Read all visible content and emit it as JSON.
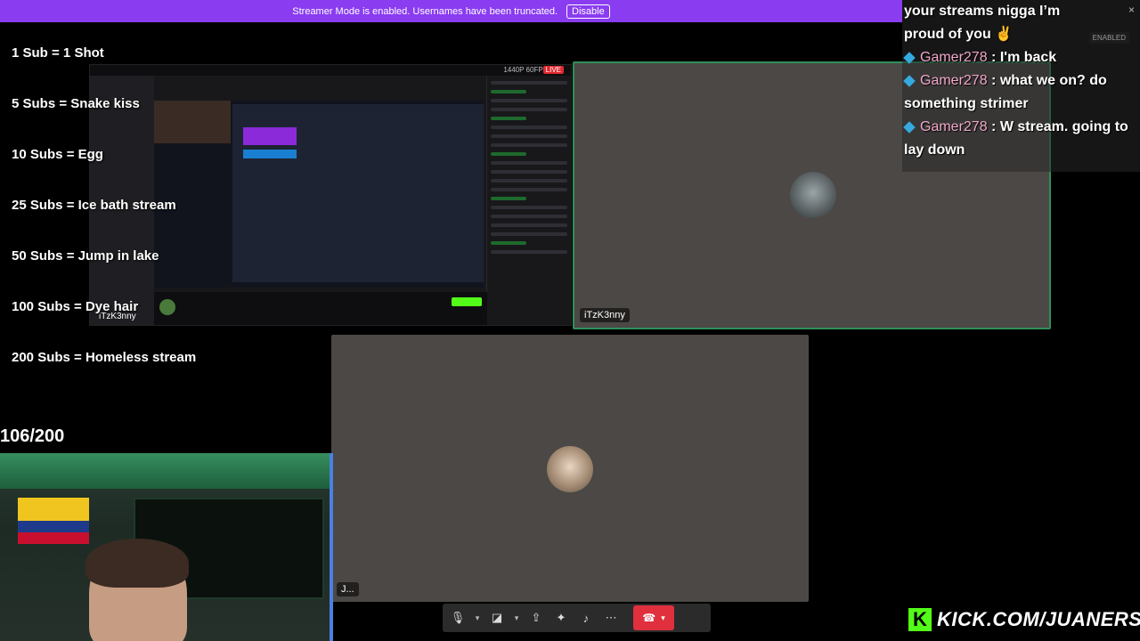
{
  "banner": {
    "text": "Streamer Mode is enabled. Usernames have been truncated.",
    "button": "Disable"
  },
  "goals": [
    "1 Sub = 1 Shot",
    "5 Subs = Snake kiss",
    "10 Subs = Egg",
    "25 Subs = Ice bath stream",
    "50 Subs = Jump in lake",
    "100 Subs = Dye hair",
    "200 Subs = Homeless stream"
  ],
  "capture": {
    "quality": "1440P 60FPS",
    "live": "LIVE",
    "streamer_label": "iTzK3nny"
  },
  "tiles": {
    "top_right": {
      "label": "iTzK3nny"
    },
    "center": {
      "label": "J..."
    }
  },
  "chat": {
    "enabled_badge": "ENABLED",
    "close": "×",
    "first_message": "your streams nigga I’m proud of you ✌",
    "messages": [
      {
        "user": "Gamer278",
        "text": "I'm back"
      },
      {
        "user": "Gamer278",
        "text": "what we on? do something strimer"
      },
      {
        "user": "Gamer278",
        "text": "W stream. going to lay down"
      }
    ]
  },
  "counter": "106/200",
  "kick": {
    "logo": "K",
    "url": "KICK.COM/JUANERSSS"
  },
  "controls": {
    "mic_icon": "🎙",
    "camera_icon": "◪",
    "share_icon": "⇪",
    "activities_icon": "✦",
    "soundboard_icon": "♪",
    "more_icon": "⋯",
    "chevron": "▾",
    "hangup_icon": "☎"
  },
  "colors": {
    "accent": "#8a3cf0",
    "kick_green": "#53fc18",
    "hangup": "#e0303e",
    "active_border": "#2f8f5a"
  }
}
